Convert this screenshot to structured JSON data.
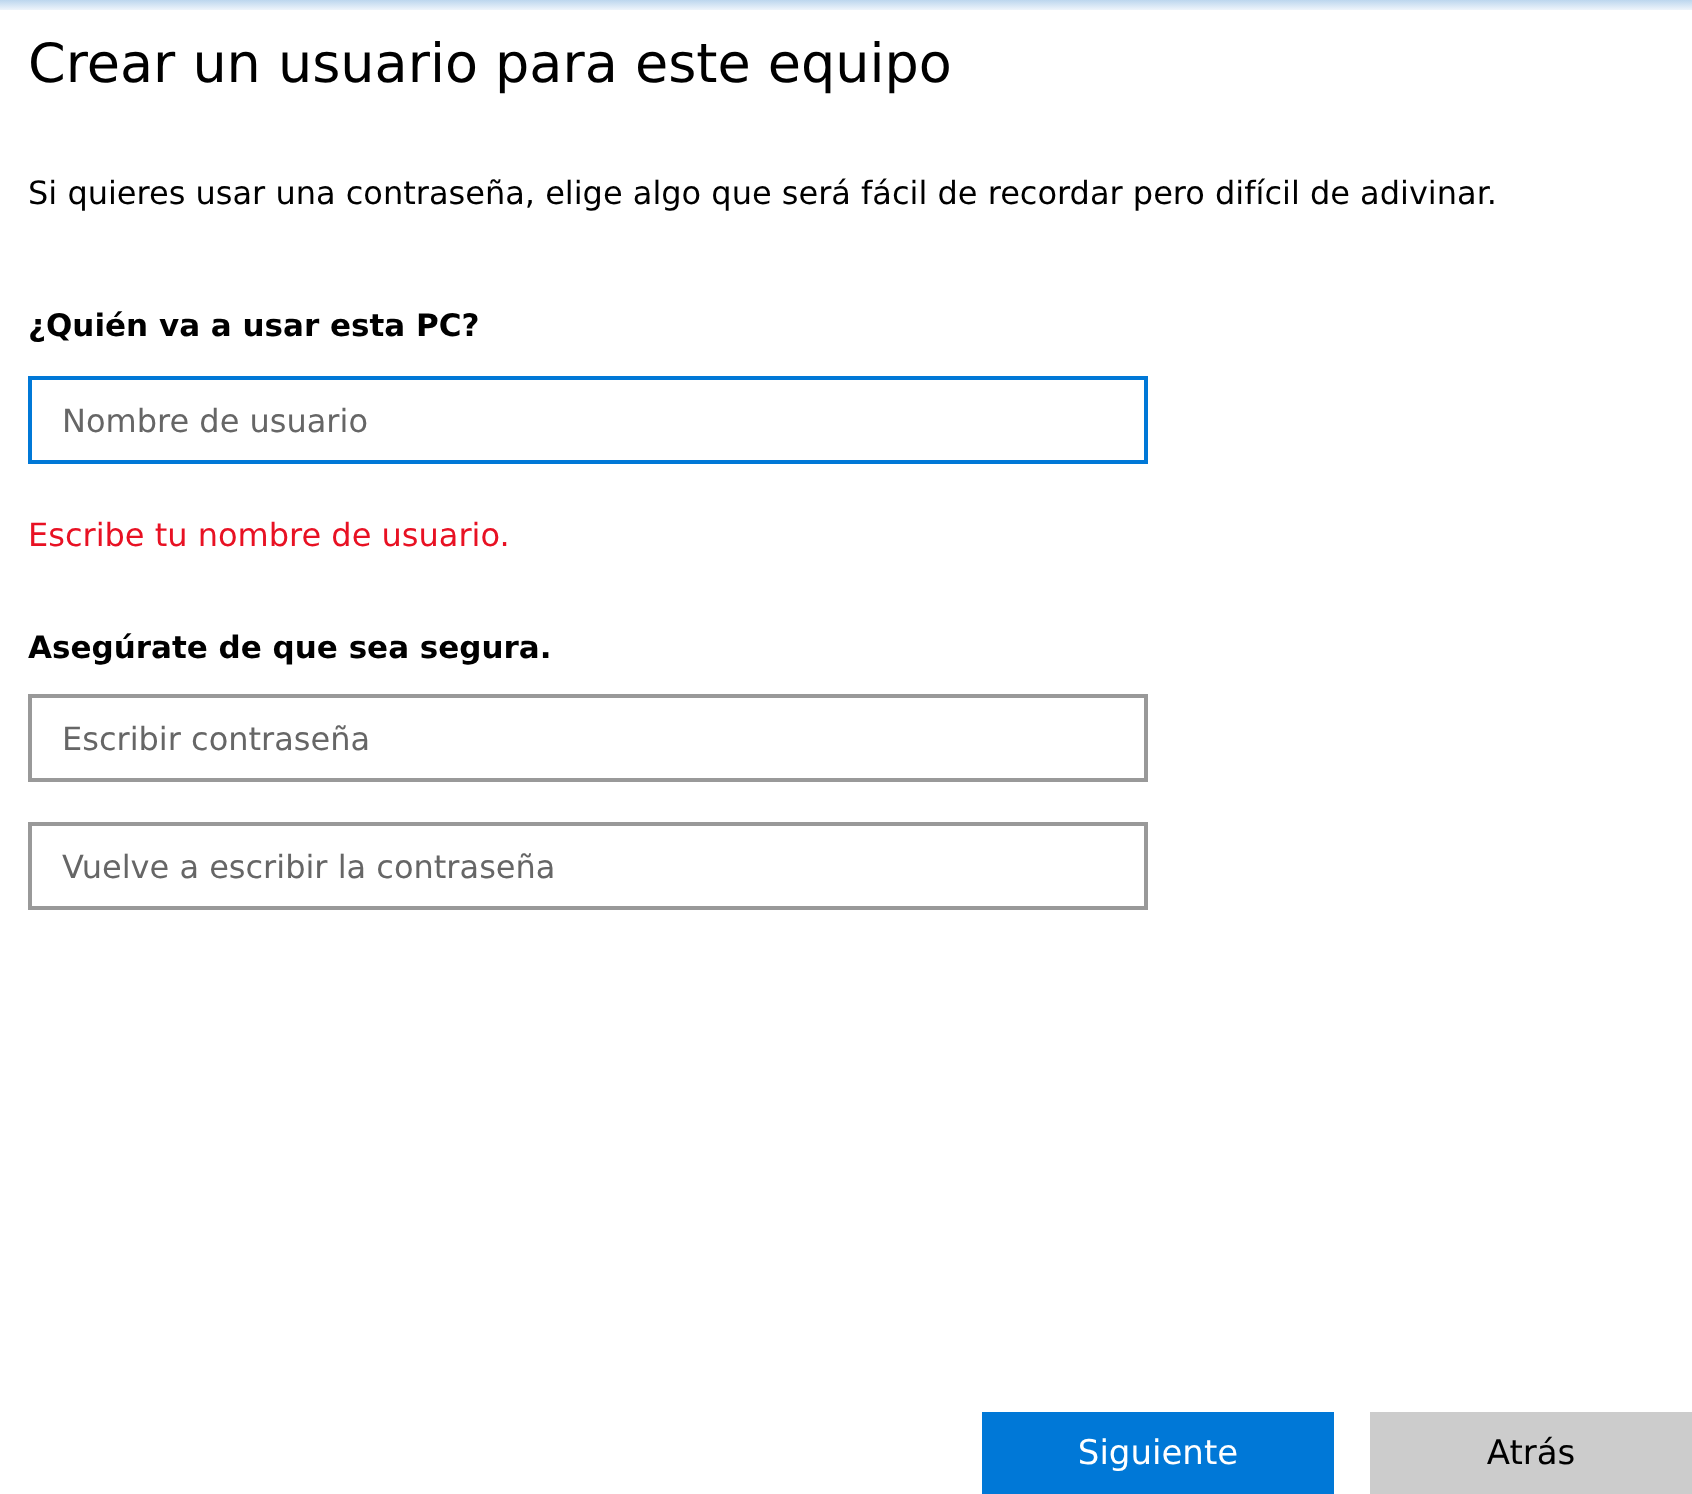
{
  "title": "Crear un usuario para este equipo",
  "intro": "Si quieres usar una contraseña, elige algo que será fácil de recordar pero difícil de adivinar.",
  "sections": [
    {
      "label": "¿Quién va a usar esta PC?",
      "fields": [
        {
          "placeholder": "Nombre de usuario",
          "focused": true
        }
      ],
      "error": "Escribe tu nombre de usuario."
    },
    {
      "label": "Asegúrate de que sea segura.",
      "fields": [
        {
          "placeholder": "Escribir contraseña",
          "focused": false
        },
        {
          "placeholder": "Vuelve a escribir la contraseña",
          "focused": false
        }
      ]
    }
  ],
  "buttons": [
    {
      "label": "Siguiente",
      "kind": "primary"
    },
    {
      "label": "Atrás",
      "kind": "secondary"
    }
  ]
}
